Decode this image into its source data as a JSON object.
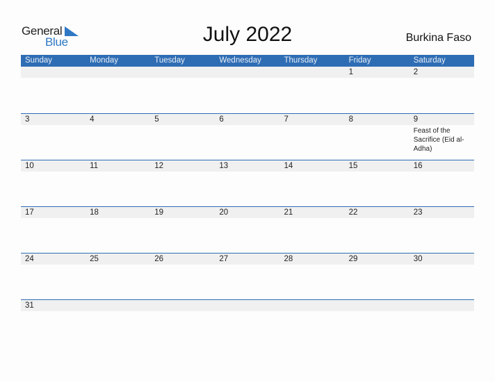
{
  "logo": {
    "general": "General",
    "blue": "Blue",
    "icon": "logo-triangle-icon",
    "accent": "#2f78c4"
  },
  "title": "July 2022",
  "country": "Burkina Faso",
  "colors": {
    "header_bg": "#2e6db4",
    "strip_bg": "#f0f0f0"
  },
  "weekdays": [
    "Sunday",
    "Monday",
    "Tuesday",
    "Wednesday",
    "Thursday",
    "Friday",
    "Saturday"
  ],
  "weeks": [
    [
      {
        "day": ""
      },
      {
        "day": ""
      },
      {
        "day": ""
      },
      {
        "day": ""
      },
      {
        "day": ""
      },
      {
        "day": "1"
      },
      {
        "day": "2"
      }
    ],
    [
      {
        "day": "3"
      },
      {
        "day": "4"
      },
      {
        "day": "5"
      },
      {
        "day": "6"
      },
      {
        "day": "7"
      },
      {
        "day": "8"
      },
      {
        "day": "9",
        "event": "Feast of the Sacrifice (Eid al-Adha)"
      }
    ],
    [
      {
        "day": "10"
      },
      {
        "day": "11"
      },
      {
        "day": "12"
      },
      {
        "day": "13"
      },
      {
        "day": "14"
      },
      {
        "day": "15"
      },
      {
        "day": "16"
      }
    ],
    [
      {
        "day": "17"
      },
      {
        "day": "18"
      },
      {
        "day": "19"
      },
      {
        "day": "20"
      },
      {
        "day": "21"
      },
      {
        "day": "22"
      },
      {
        "day": "23"
      }
    ],
    [
      {
        "day": "24"
      },
      {
        "day": "25"
      },
      {
        "day": "26"
      },
      {
        "day": "27"
      },
      {
        "day": "28"
      },
      {
        "day": "29"
      },
      {
        "day": "30"
      }
    ],
    [
      {
        "day": "31"
      },
      {
        "day": ""
      },
      {
        "day": ""
      },
      {
        "day": ""
      },
      {
        "day": ""
      },
      {
        "day": ""
      },
      {
        "day": ""
      }
    ]
  ]
}
